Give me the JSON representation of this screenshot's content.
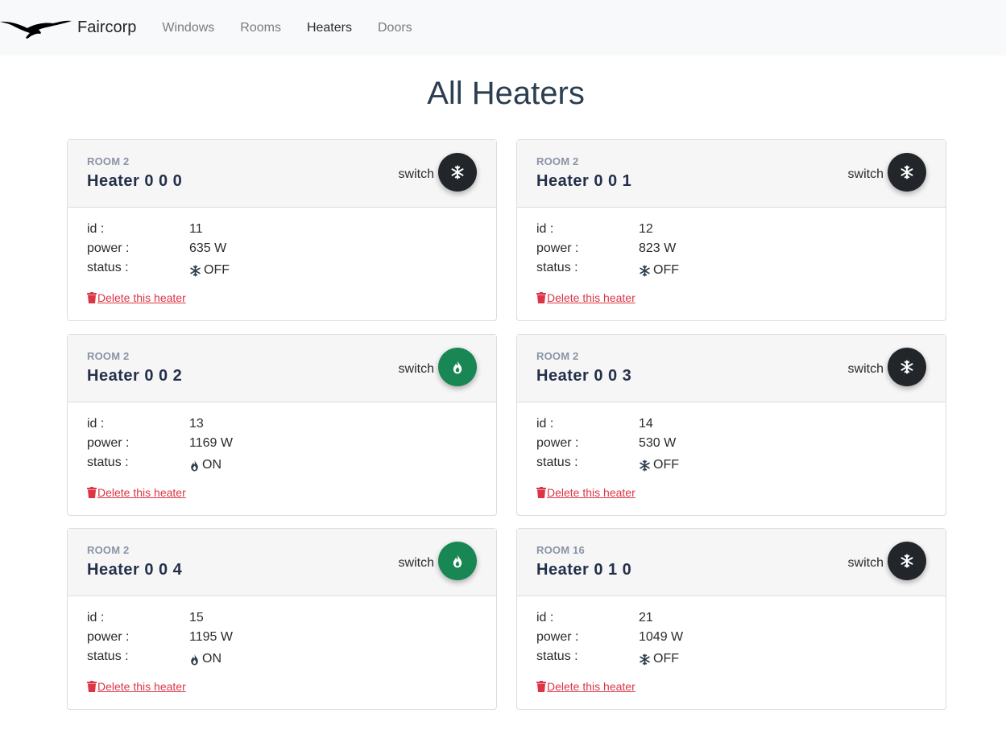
{
  "nav": {
    "brand": "Faircorp",
    "links": [
      {
        "label": "Windows",
        "active": false
      },
      {
        "label": "Rooms",
        "active": false
      },
      {
        "label": "Heaters",
        "active": true
      },
      {
        "label": "Doors",
        "active": false
      }
    ]
  },
  "page": {
    "title": "All Heaters"
  },
  "labels": {
    "switch": "switch",
    "id": "id :",
    "power": "power :",
    "status": "status :",
    "delete": "Delete this heater"
  },
  "colors": {
    "on": "#198754",
    "off": "#222529",
    "danger": "#dc3545"
  },
  "heaters": [
    {
      "room": "ROOM 2",
      "name": "Heater 0 0 0",
      "id": "11",
      "power": "635 W",
      "status": "OFF",
      "icon": "snowflake-icon"
    },
    {
      "room": "ROOM 2",
      "name": "Heater 0 0 1",
      "id": "12",
      "power": "823 W",
      "status": "OFF",
      "icon": "snowflake-icon"
    },
    {
      "room": "ROOM 2",
      "name": "Heater 0 0 2",
      "id": "13",
      "power": "1169 W",
      "status": "ON",
      "icon": "fire-icon"
    },
    {
      "room": "ROOM 2",
      "name": "Heater 0 0 3",
      "id": "14",
      "power": "530 W",
      "status": "OFF",
      "icon": "snowflake-icon"
    },
    {
      "room": "ROOM 2",
      "name": "Heater 0 0 4",
      "id": "15",
      "power": "1195 W",
      "status": "ON",
      "icon": "fire-icon"
    },
    {
      "room": "ROOM 16",
      "name": "Heater 0 1 0",
      "id": "21",
      "power": "1049 W",
      "status": "OFF",
      "icon": "snowflake-icon"
    }
  ]
}
